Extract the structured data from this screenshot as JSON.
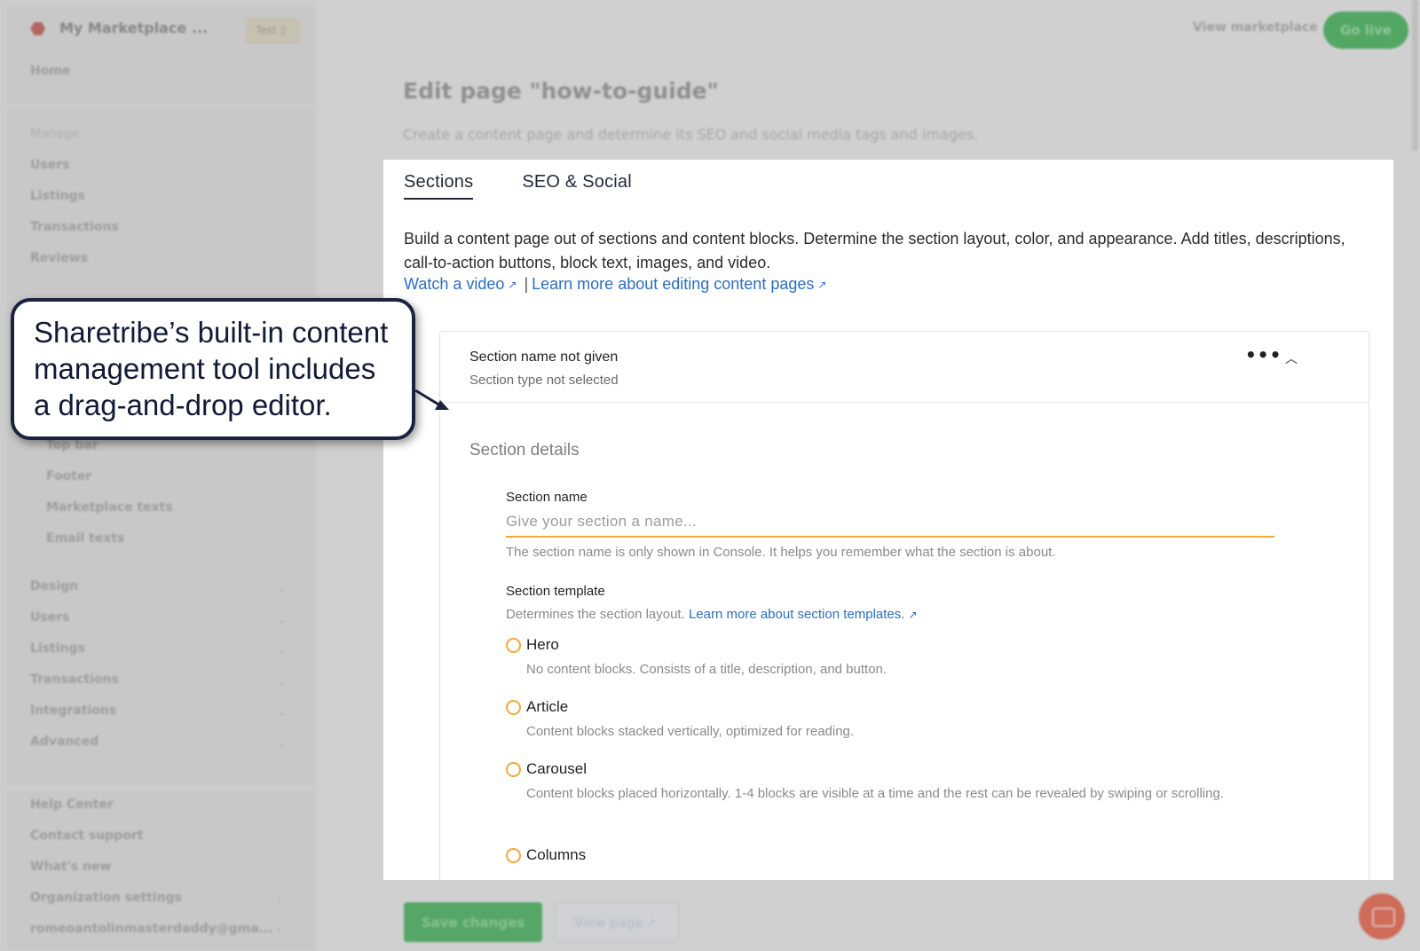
{
  "topbar": {
    "marketplace_name": "My Marketplace ...",
    "env_badge": "Test",
    "view_marketplace": "View marketplace",
    "go_live": "Go live"
  },
  "sidebar": {
    "home": "Home",
    "manage_heading": "Manage",
    "manage_items": [
      "Users",
      "Listings",
      "Transactions",
      "Reviews"
    ],
    "content_sub_items": [
      "Top bar",
      "Footer",
      "Marketplace texts",
      "Email texts"
    ],
    "groups": [
      "Design",
      "Users",
      "Listings",
      "Transactions",
      "Integrations",
      "Advanced"
    ],
    "help_items": [
      "Help Center",
      "Contact support",
      "What's new",
      "Organization settings",
      "romeoantolinmasterdaddy@gma..."
    ]
  },
  "page": {
    "title": "Edit page \"how-to-guide\"",
    "subtitle": "Create a content page and determine its SEO and social media tags and images."
  },
  "tabs": [
    "Sections",
    "SEO & Social"
  ],
  "intro": {
    "text": "Build a content page out of sections and content blocks. Determine the section layout, color, and appearance. Add titles, descriptions, call-to-action buttons, block text, images, and video.",
    "watch_video": "Watch a video",
    "separator": "|",
    "learn_more": "Learn more about editing content pages"
  },
  "section": {
    "name": "Section name not given",
    "type": "Section type not selected",
    "details_title": "Section details",
    "name_label": "Section name",
    "name_value": "",
    "name_placeholder": "Give your section a name...",
    "name_hint": "The section name is only shown in Console. It helps you remember what the section is about.",
    "template_label": "Section template",
    "template_hint": "Determines the section layout.",
    "template_link": "Learn more about section templates.",
    "templates": [
      {
        "label": "Hero",
        "desc": "No content blocks. Consists of a title, description, and button."
      },
      {
        "label": "Article",
        "desc": "Content blocks stacked vertically, optimized for reading."
      },
      {
        "label": "Carousel",
        "desc": "Content blocks placed horizontally. 1-4 blocks are visible at a time and the rest can be revealed by swiping or scrolling."
      },
      {
        "label": "Columns",
        "desc": ""
      }
    ]
  },
  "footer": {
    "save": "Save changes",
    "view_page": "View page"
  },
  "callout": {
    "text": "Sharetribe’s built-in content management tool includes a drag-and-drop editor."
  },
  "colors": {
    "accent_orange": "#f2a93b",
    "link_blue": "#2a6fc4",
    "brand_green": "#2a9a41",
    "callout_border": "#1a2240"
  }
}
